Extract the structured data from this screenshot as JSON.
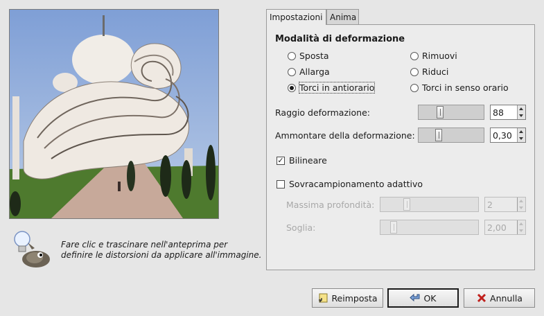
{
  "tabs": [
    {
      "label": "Impostazioni"
    },
    {
      "label": "Anima"
    }
  ],
  "mode": {
    "title": "Modalità di deformazione",
    "options": [
      {
        "label": "Sposta",
        "selected": false
      },
      {
        "label": "Allarga",
        "selected": false
      },
      {
        "label": "Torci in antiorario",
        "selected": true
      },
      {
        "label": "Rimuovi",
        "selected": false
      },
      {
        "label": "Riduci",
        "selected": false
      },
      {
        "label": "Torci in senso orario",
        "selected": false
      }
    ]
  },
  "radius": {
    "label": "Raggio deformazione:",
    "value": "88"
  },
  "amount": {
    "label": "Ammontare della deformazione:",
    "value": "0,30"
  },
  "bilinear": {
    "label": "Bilineare",
    "checked": true
  },
  "supersample": {
    "label": "Sovracampionamento adattivo",
    "checked": false
  },
  "max_depth": {
    "label": "Massima profondità:",
    "value": "2"
  },
  "threshold": {
    "label": "Soglia:",
    "value": "2,00"
  },
  "hint": "Fare clic e trascinare nell'anteprima per definire le distorsioni da applicare all'immagine.",
  "buttons": {
    "reset": "Reimposta",
    "ok": "OK",
    "cancel": "Annulla"
  }
}
